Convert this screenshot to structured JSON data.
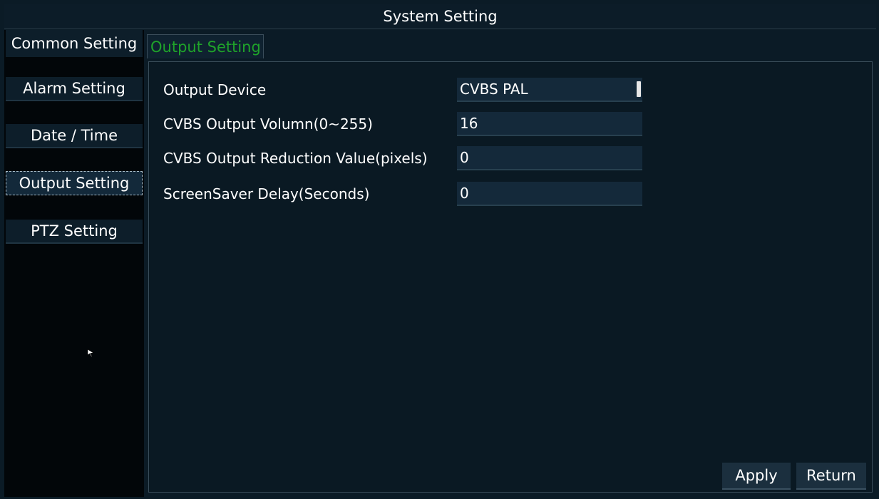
{
  "window": {
    "title": "System Setting"
  },
  "sidebar": {
    "items": [
      {
        "label": "Common Setting"
      },
      {
        "label": "Alarm Setting"
      },
      {
        "label": "Date / Time"
      },
      {
        "label": "Output Setting"
      },
      {
        "label": "PTZ Setting"
      }
    ]
  },
  "main": {
    "tab": "Output Setting",
    "fields": [
      {
        "label": "Output Device",
        "value": "CVBS PAL"
      },
      {
        "label": "CVBS Output Volumn(0~255)",
        "value": "16"
      },
      {
        "label": "CVBS Output Reduction Value(pixels)",
        "value": "0"
      },
      {
        "label": "ScreenSaver Delay(Seconds)",
        "value": "0"
      }
    ]
  },
  "buttons": {
    "apply": "Apply",
    "return": "Return"
  },
  "colors": {
    "tab_active": "#1fa32a",
    "background": "#0b1b26"
  }
}
